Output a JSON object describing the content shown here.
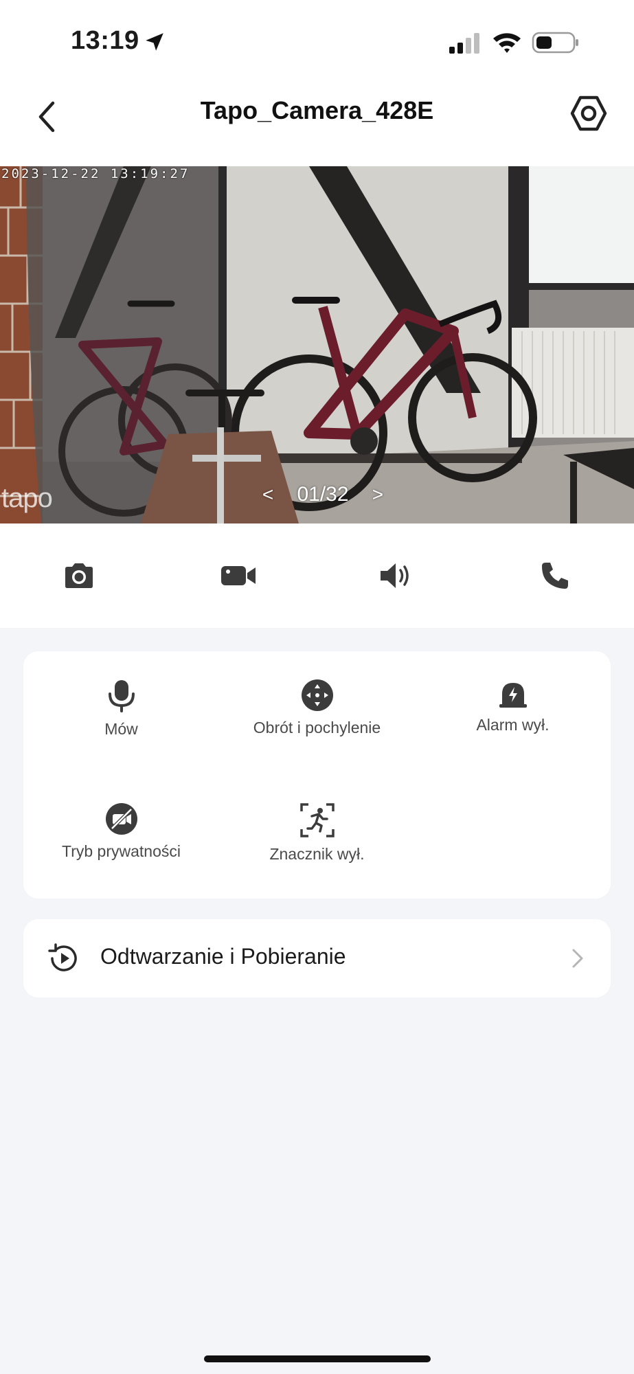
{
  "status_bar": {
    "time": "13:19"
  },
  "nav": {
    "title": "Tapo_Camera_428E"
  },
  "video": {
    "timestamp": "2023-12-22 13:19:27",
    "watermark": "tapo",
    "pager": {
      "prev": "<",
      "position": "01/32",
      "next": ">"
    }
  },
  "toolbar": {
    "icons": [
      "camera-icon",
      "video-record-icon",
      "speaker-icon",
      "phone-icon"
    ]
  },
  "controls": [
    {
      "label": "Mów",
      "icon": "microphone-icon"
    },
    {
      "label": "Obrót i pochylenie",
      "icon": "pan-tilt-icon"
    },
    {
      "label": "Alarm wył.",
      "icon": "alarm-icon"
    },
    {
      "label": "Tryb prywatności",
      "icon": "privacy-mode-icon"
    },
    {
      "label": "Znacznik wył.",
      "icon": "motion-marker-icon"
    }
  ],
  "playback": {
    "label": "Odtwarzanie i Pobieranie"
  },
  "colors": {
    "background": "#f4f5f8",
    "card": "#ffffff",
    "icon": "#3c3c3c",
    "text_primary": "#1b1b1b",
    "text_secondary": "#4a4a4a"
  }
}
